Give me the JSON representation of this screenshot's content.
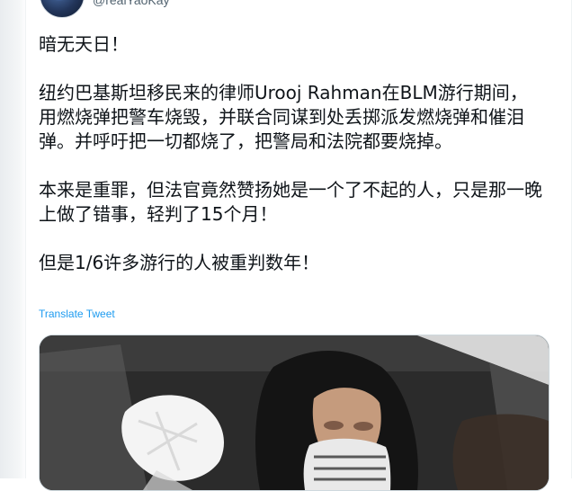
{
  "tweet": {
    "handle": "@realYaoKay",
    "paragraphs": [
      "暗无天日！",
      "纽约巴基斯坦移民来的律师Urooj Rahman在BLM游行期间，用燃烧弹把警车烧毁，并联合同谋到处丢掷派发燃烧弹和催泪弹。并呼吁把一切都烧了，把警局和法院都要烧掉。",
      "本来是重罪，但法官竟然赞扬她是一个了不起的人，只是那一晚上做了错事，轻判了15个月！",
      "但是1/6许多游行的人被重判数年！"
    ],
    "translate_label": "Translate Tweet"
  },
  "colors": {
    "text": "#0f1419",
    "secondary": "#536471",
    "link": "#1d9bf0",
    "border": "#cfd9de"
  },
  "icons": {
    "avatar": "globe-avatar"
  }
}
